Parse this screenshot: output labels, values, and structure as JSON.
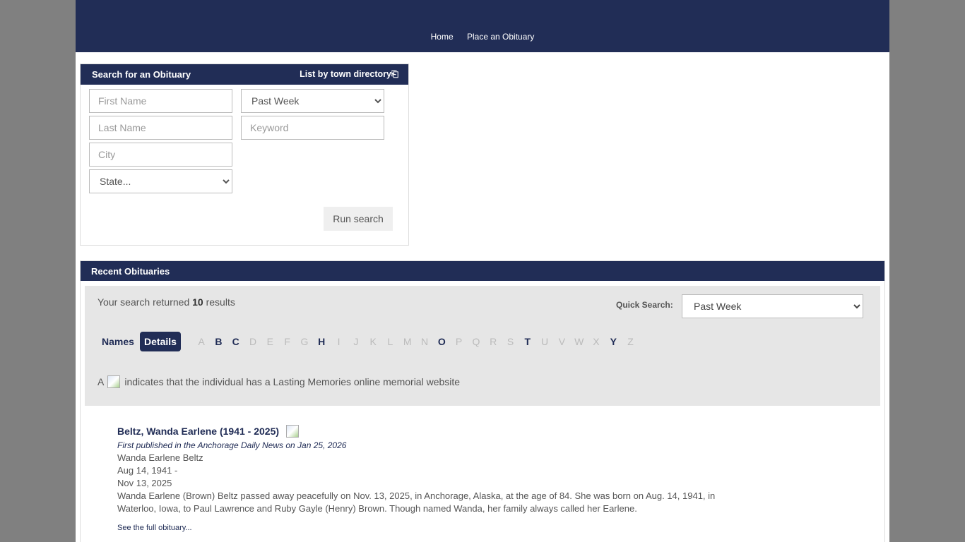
{
  "nav": {
    "home": "Home",
    "place": "Place an Obituary"
  },
  "search": {
    "title": "Search for an Obituary",
    "directory": "List by town directory⎗",
    "first_name_placeholder": "First Name",
    "last_name_placeholder": "Last Name",
    "city_placeholder": "City",
    "state_value": "State...",
    "period_value": "Past Week",
    "keyword_placeholder": "Keyword",
    "run_label": "Run search"
  },
  "recent": {
    "title": "Recent Obituaries",
    "results_prefix": "Your search returned ",
    "results_count": "10",
    "results_suffix": " results",
    "quick_search_label": "Quick Search:",
    "quick_search_value": "Past Week",
    "view_names": "Names",
    "view_details": "Details",
    "legend_prefix": "A ",
    "legend_suffix": " indicates that the individual has a Lasting Memories online memorial website"
  },
  "letters": [
    {
      "l": "A",
      "enabled": false
    },
    {
      "l": "B",
      "enabled": true
    },
    {
      "l": "C",
      "enabled": true
    },
    {
      "l": "D",
      "enabled": false
    },
    {
      "l": "E",
      "enabled": false
    },
    {
      "l": "F",
      "enabled": false
    },
    {
      "l": "G",
      "enabled": false
    },
    {
      "l": "H",
      "enabled": true
    },
    {
      "l": "I",
      "enabled": false
    },
    {
      "l": "J",
      "enabled": false
    },
    {
      "l": "K",
      "enabled": false
    },
    {
      "l": "L",
      "enabled": false
    },
    {
      "l": "M",
      "enabled": false
    },
    {
      "l": "N",
      "enabled": false
    },
    {
      "l": "O",
      "enabled": true
    },
    {
      "l": "P",
      "enabled": false
    },
    {
      "l": "Q",
      "enabled": false
    },
    {
      "l": "R",
      "enabled": false
    },
    {
      "l": "S",
      "enabled": false
    },
    {
      "l": "T",
      "enabled": true
    },
    {
      "l": "U",
      "enabled": false
    },
    {
      "l": "V",
      "enabled": false
    },
    {
      "l": "W",
      "enabled": false
    },
    {
      "l": "X",
      "enabled": false
    },
    {
      "l": "Y",
      "enabled": true
    },
    {
      "l": "Z",
      "enabled": false
    }
  ],
  "obituary": {
    "name": "Beltz, Wanda Earlene (1941 - 2025)",
    "published": "First published in the Anchorage Daily News on Jan 25, 2026",
    "line1": "Wanda Earlene Beltz",
    "line2": "Aug 14, 1941 -",
    "line3": "Nov 13, 2025",
    "line4": "Wanda Earlene (Brown) Beltz passed away peacefully on Nov. 13, 2025, in Anchorage, Alaska, at the age of 84. She was born on Aug. 14, 1941, in",
    "line5": "Waterloo, Iowa, to Paul Lawrence and Ruby Gayle (Henry) Brown. Though named Wanda, her family always called her Earlene.",
    "more": "See the full obituary..."
  }
}
